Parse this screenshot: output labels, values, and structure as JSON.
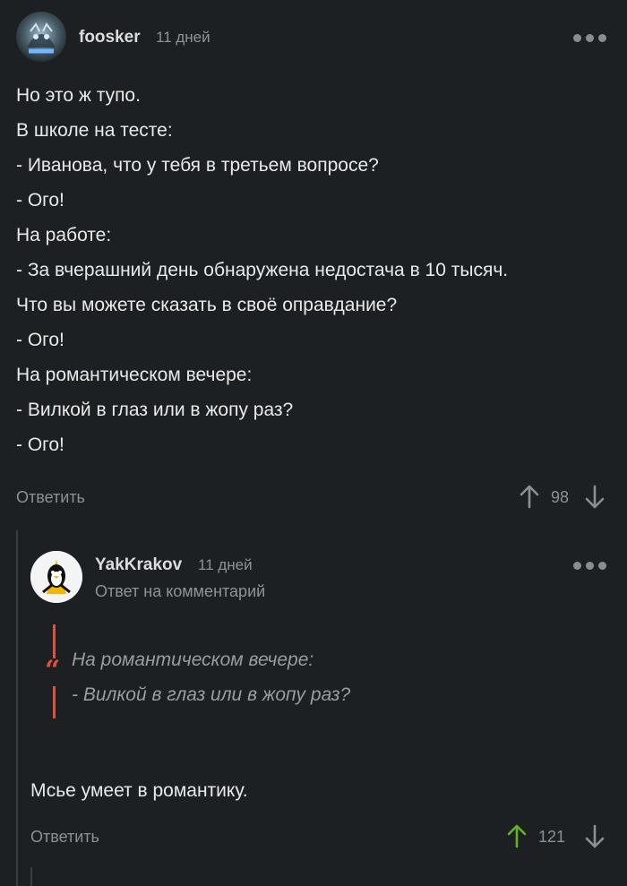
{
  "comment1": {
    "username": "foosker",
    "time": "11 дней",
    "lines": [
      "Но это ж тупо.",
      "В школе на тесте:",
      "- Иванова, что у тебя в третьем вопросе?",
      "- Ого!",
      "На работе:",
      "- За вчерашний день обнаружена недостача в 10 тысяч.",
      "Что вы можете сказать в своё оправдание?",
      "- Ого!",
      "На романтическом вечере:",
      "- Вилкой в глаз или в жопу раз?",
      "- Ого!"
    ],
    "reply_label": "Ответить",
    "score": "98"
  },
  "comment2": {
    "username": "YakKrakov",
    "time": "11 дней",
    "subtitle": "Ответ на комментарий",
    "quote_mark": "“",
    "quote_lines": [
      "На романтическом вечере:",
      "- Вилкой в глаз или в жопу раз?"
    ],
    "text": "Мсье умеет в романтику.",
    "reply_label": "Ответить",
    "score": "121"
  },
  "colors": {
    "background": "#1d2022",
    "upvote_active": "#6ab024",
    "quote_bar": "#e0503f",
    "muted": "#8d9093"
  },
  "icons": {
    "more": "more-dots-icon",
    "upvote": "arrow-up-icon",
    "downvote": "arrow-down-icon",
    "quote": "quote-icon"
  }
}
